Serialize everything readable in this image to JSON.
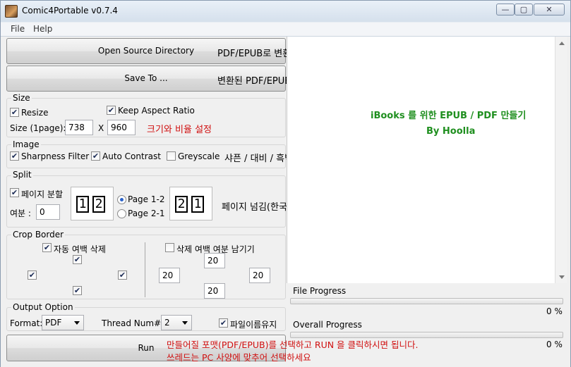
{
  "window": {
    "title": "Comic4Portable v0.7.4",
    "min_glyph": "—",
    "max_glyph": "▢",
    "close_glyph": "✕"
  },
  "menu": {
    "file": "File",
    "help": "Help"
  },
  "source": {
    "button": "Open Source Directory",
    "hint": "PDF/EPUB로 변환할 JPG의 디렉토리"
  },
  "saveto": {
    "button": "Save To ...",
    "hint": "변환된 PDF/EPUB 문서를 저장할 디렉토리"
  },
  "size": {
    "group": "Size",
    "resize": "Resize",
    "keep_aspect": "Keep Aspect Ratio",
    "size_label": "Size (1page):",
    "width": "738",
    "x": "X",
    "height": "960",
    "hint": "크기와 비율 설정"
  },
  "image": {
    "group": "Image",
    "sharpness": "Sharpness Filter",
    "contrast": "Auto Contrast",
    "greyscale": "Greyscale",
    "hint": "샤픈 / 대비 / 흑백 설정"
  },
  "split": {
    "group": "Split",
    "page_split": "페이지 분할",
    "margin_label": "여분 :",
    "margin_value": "0",
    "ltr": [
      "1",
      "2"
    ],
    "rtl": [
      "2",
      "1"
    ],
    "option1": "Page 1-2",
    "option2": "Page 2-1",
    "hint": "페이지 넘김(한국/일본식)"
  },
  "crop": {
    "group": "Crop Border",
    "auto": "자동 여백 삭제",
    "keep": "삭제 여백 여분 남기기",
    "top": "20",
    "left": "20",
    "right": "20",
    "bottom": "20"
  },
  "output": {
    "group": "Output Option",
    "format_label": "Format:",
    "format_value": "PDF",
    "thread_label": "Thread Num#:",
    "thread_value": "2",
    "keep_name": "파일이름유지"
  },
  "run": {
    "button": "Run",
    "hint1": "만들어질 포맷(PDF/EPUB)를 선택하고 RUN 을 클릭하시면 됩니다.",
    "hint2": "쓰레드는 PC 사양에 맞추어 선택하세요"
  },
  "info": {
    "line1": "iBooks 를 위한 EPUB / PDF 만들기",
    "line2": "By Hoolla"
  },
  "progress": {
    "file_label": "File Progress",
    "file_value": "0 %",
    "file_fraction": 0,
    "overall_label": "Overall Progress",
    "overall_value": "0 %",
    "overall_fraction": 0
  },
  "colors": {
    "accent_green": "#1f8f1f",
    "hint_red": "#d01010"
  }
}
